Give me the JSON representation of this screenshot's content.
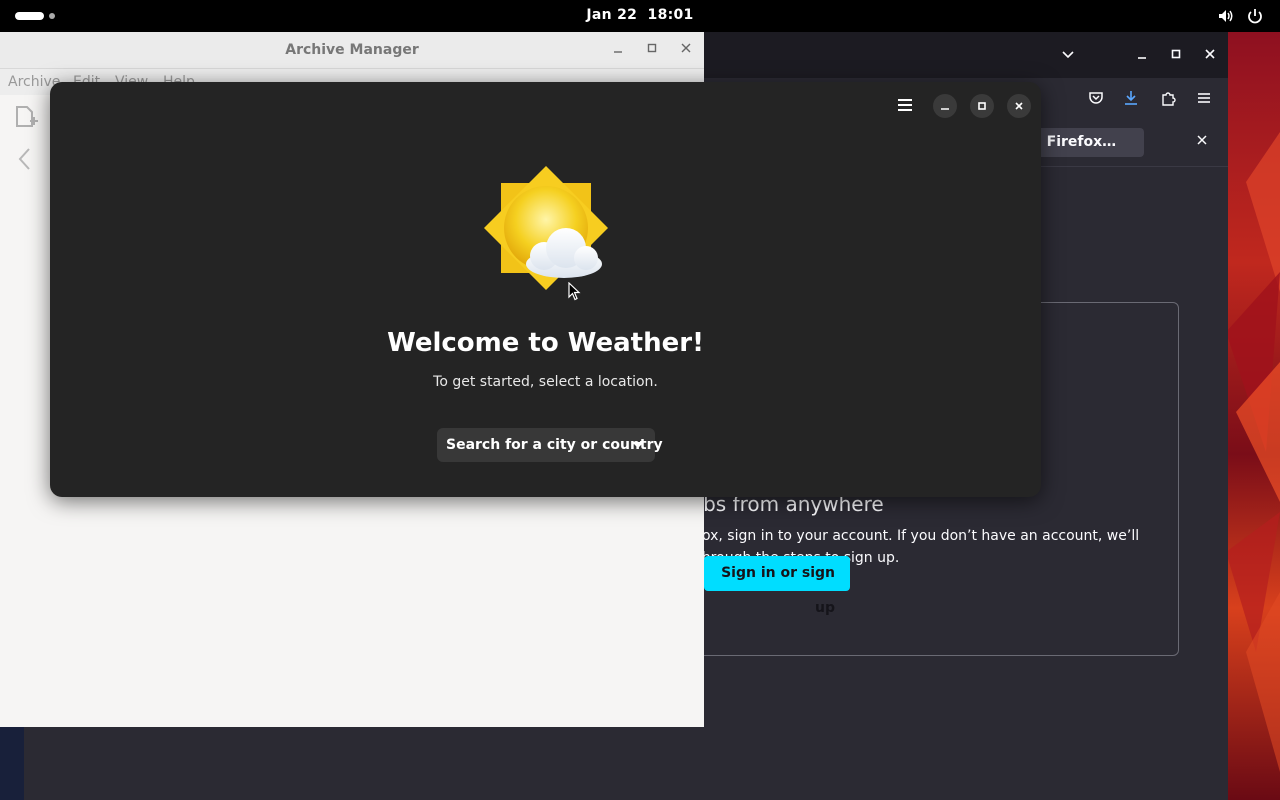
{
  "topbar": {
    "date": "Jan 22",
    "time": "18:01",
    "icons": [
      "activities-indicator",
      "volume-icon",
      "power-icon"
    ]
  },
  "firefox": {
    "notification_tab": "esh Firefox…",
    "card": {
      "heading": "tabs from anywhere",
      "body_line1": "refox, sign in to your account. If you don’t have an account, we’ll",
      "body_line2": "u through the steps to sign up.",
      "button": "Sign in or sign up"
    },
    "icons": [
      "chevron-down-icon",
      "minimize-icon",
      "maximize-icon",
      "close-icon",
      "pocket-icon",
      "downloads-icon",
      "extensions-icon",
      "hamburger-menu-icon",
      "close-icon"
    ],
    "accent_color": "#00ddff"
  },
  "archive_manager": {
    "title": "Archive Manager",
    "menus": [
      "Archive",
      "Edit",
      "View",
      "Help"
    ],
    "icons": [
      "new-archive-icon",
      "back-arrow-icon",
      "minimize-icon",
      "maximize-icon",
      "close-icon"
    ]
  },
  "weather": {
    "title": "Welcome to Weather!",
    "subtitle": "To get started, select a location.",
    "search_button": "Search for a city or country",
    "icons": [
      "hamburger-menu-icon",
      "minimize-icon",
      "maximize-icon",
      "close-icon",
      "sun-cloud-icon",
      "dropdown-caret-icon"
    ]
  }
}
